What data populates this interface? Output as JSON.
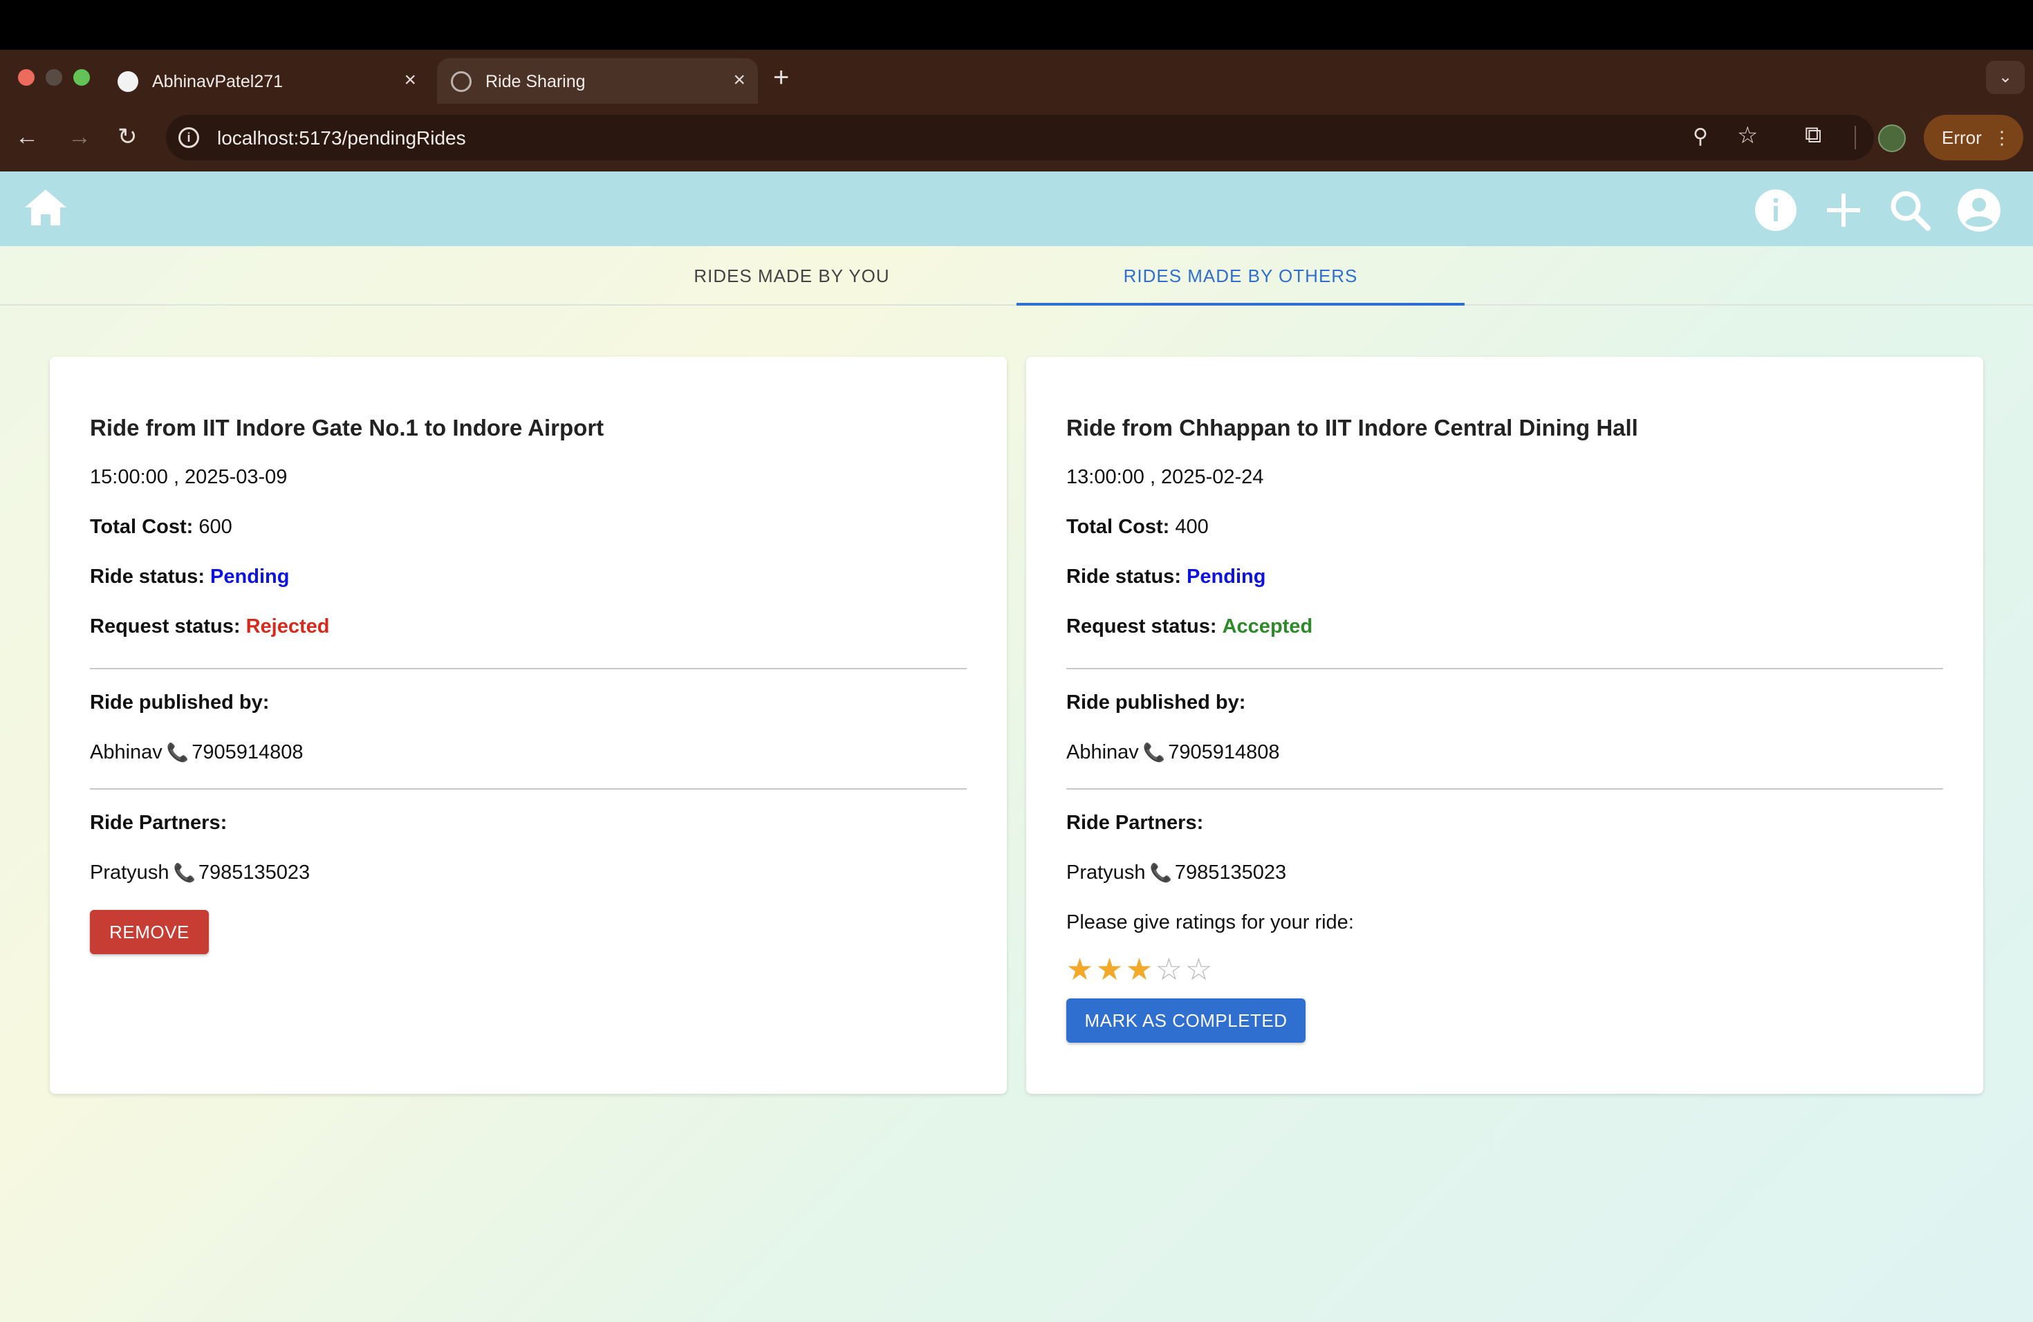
{
  "browser": {
    "tabs": [
      {
        "title": "AbhinavPatel271",
        "icon": "github-icon"
      },
      {
        "title": "Ride Sharing",
        "icon": "globe-icon"
      }
    ],
    "tab_close": "×",
    "new_tab": "+",
    "tab_menu": "⌄",
    "url": "localhost:5173/pendingRides",
    "profile_status": "Error"
  },
  "appbar": {
    "icons": [
      "home-icon",
      "info-icon",
      "add-icon",
      "search-icon",
      "account-icon"
    ],
    "color": "#b0dfe5"
  },
  "page_tabs": {
    "items": [
      "RIDES MADE BY YOU",
      "RIDES MADE BY OTHERS"
    ],
    "selected": "RIDES MADE BY OTHERS"
  },
  "rides": [
    {
      "title": "Ride from IIT Indore Gate No.1 to Indore Airport",
      "datetime": "15:00:00 , 2025-03-09",
      "cost_label": "Total Cost:",
      "cost": "600",
      "ride_status_label": "Ride status:",
      "ride_status": "Pending",
      "request_status_label": "Request status:",
      "request_status": "Rejected",
      "published_label": "Ride published by:",
      "publisher_name": "Abhinav",
      "publisher_phone": "7905914808",
      "partners_label": "Ride Partners:",
      "partner_name": "Pratyush",
      "partner_phone": "7985135023",
      "action": "REMOVE"
    },
    {
      "title": "Ride from Chhappan to IIT Indore Central Dining Hall",
      "datetime": "13:00:00 , 2025-02-24",
      "cost_label": "Total Cost:",
      "cost": "400",
      "ride_status_label": "Ride status:",
      "ride_status": "Pending",
      "request_status_label": "Request status:",
      "request_status": "Accepted",
      "published_label": "Ride published by:",
      "publisher_name": "Abhinav",
      "publisher_phone": "7905914808",
      "partners_label": "Ride Partners:",
      "partner_name": "Pratyush",
      "partner_phone": "7985135023",
      "rating_prompt": "Please give ratings for your ride:",
      "rating": 3,
      "rating_max": 5,
      "action": "MARK AS COMPLETED"
    }
  ],
  "colors": {
    "pending": "#0c12e0",
    "rejected": "#d62a1c",
    "accepted": "#2c8a28",
    "remove_button": "#c73c33",
    "primary": "#2f6fd0",
    "star": "#f2a92a"
  }
}
